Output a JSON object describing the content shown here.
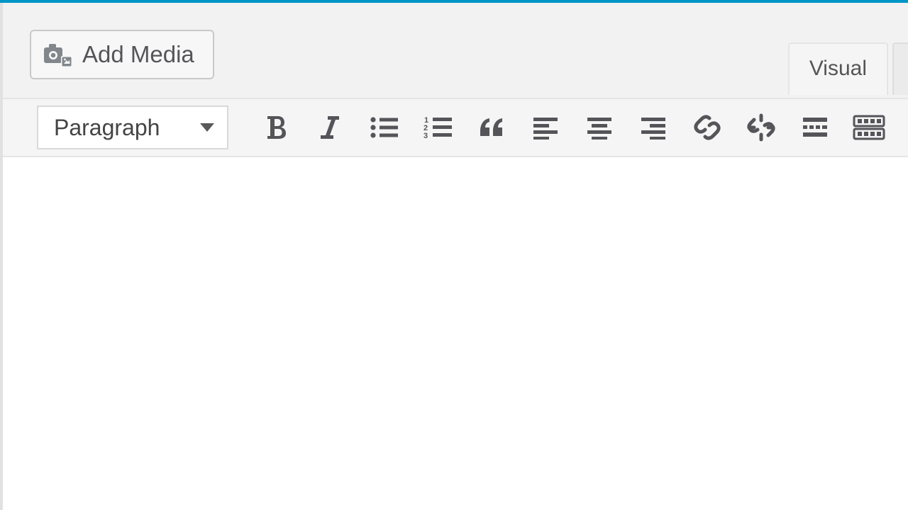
{
  "media": {
    "add_label": "Add Media"
  },
  "tabs": {
    "visual": "Visual"
  },
  "toolbar": {
    "format_selected": "Paragraph",
    "buttons": {
      "bold": "bold",
      "italic": "italic",
      "ul": "bulleted-list",
      "ol": "numbered-list",
      "quote": "blockquote",
      "align_left": "align-left",
      "align_center": "align-center",
      "align_right": "align-right",
      "link": "insert-link",
      "unlink": "remove-link",
      "more": "insert-more",
      "kitchen_sink": "toolbar-toggle"
    }
  }
}
